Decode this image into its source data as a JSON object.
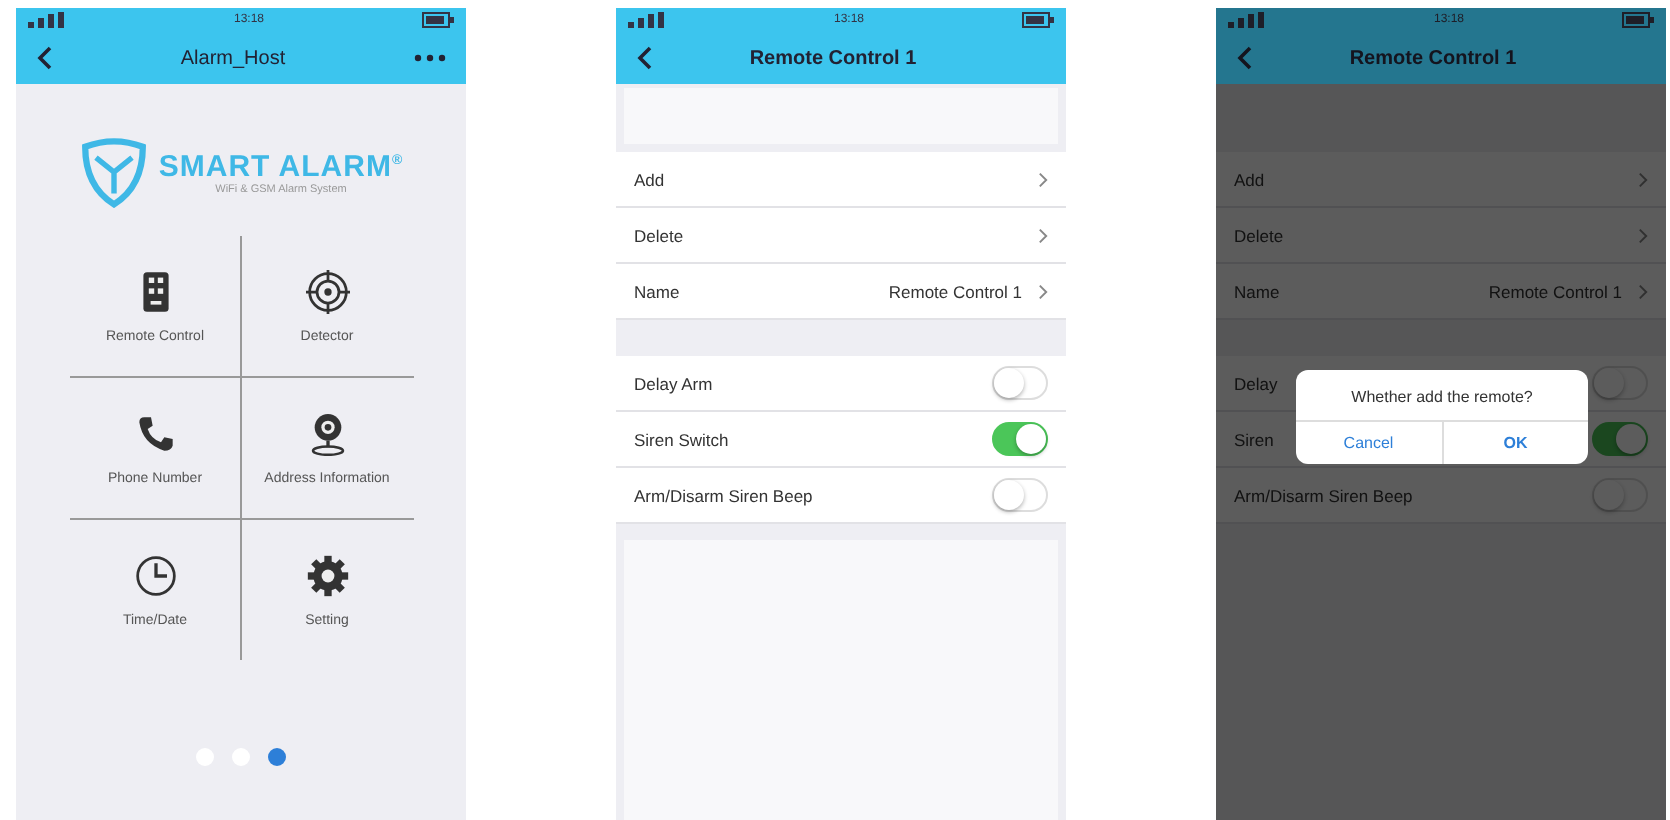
{
  "screens": [
    {
      "kind": "home",
      "status_time": "13:18",
      "title": "Alarm_Host",
      "logo": {
        "name": "SMART ALARM",
        "mark": "®",
        "subtitle": "WiFi & GSM Alarm System"
      },
      "menu": [
        {
          "label": "Remote Control",
          "kind": "remote"
        },
        {
          "label": "Detector",
          "kind": "detector"
        },
        {
          "label": "Phone Number",
          "kind": "phone"
        },
        {
          "label": "Address Information",
          "kind": "address"
        },
        {
          "label": "Time/Date",
          "kind": "clock"
        },
        {
          "label": "Setting",
          "kind": "gear"
        }
      ],
      "pages": [
        {
          "selected": false
        },
        {
          "selected": false
        },
        {
          "selected": true
        }
      ]
    },
    {
      "kind": "settings",
      "status_time": "13:18",
      "title": "Remote Control 1",
      "dimmed": false,
      "rows": [
        {
          "kind": "link",
          "label": "Add"
        },
        {
          "kind": "link",
          "label": "Delete"
        },
        {
          "kind": "link",
          "label": "Name",
          "value": "Remote Control 1"
        },
        {
          "kind": "gap"
        },
        {
          "kind": "toggle",
          "label": "Delay Arm",
          "on": false
        },
        {
          "kind": "toggle",
          "label": "Siren Switch",
          "on": true
        },
        {
          "kind": "toggle",
          "label": "Arm/Disarm Siren Beep",
          "on": false
        }
      ]
    },
    {
      "kind": "settings",
      "status_time": "13:18",
      "title": "Remote Control 1",
      "dimmed": true,
      "rows": [
        {
          "kind": "link",
          "label": "Add"
        },
        {
          "kind": "link",
          "label": "Delete"
        },
        {
          "kind": "link",
          "label": "Name",
          "value": "Remote Control 1"
        },
        {
          "kind": "gap"
        },
        {
          "kind": "toggle",
          "label": "Delay",
          "on": false
        },
        {
          "kind": "toggle",
          "label": "Siren",
          "on": true
        },
        {
          "kind": "toggle",
          "label": "Arm/Disarm Siren Beep",
          "on": false
        }
      ],
      "dialog": {
        "message": "Whether add the remote?",
        "buttons": [
          "Cancel",
          "OK"
        ]
      }
    }
  ]
}
